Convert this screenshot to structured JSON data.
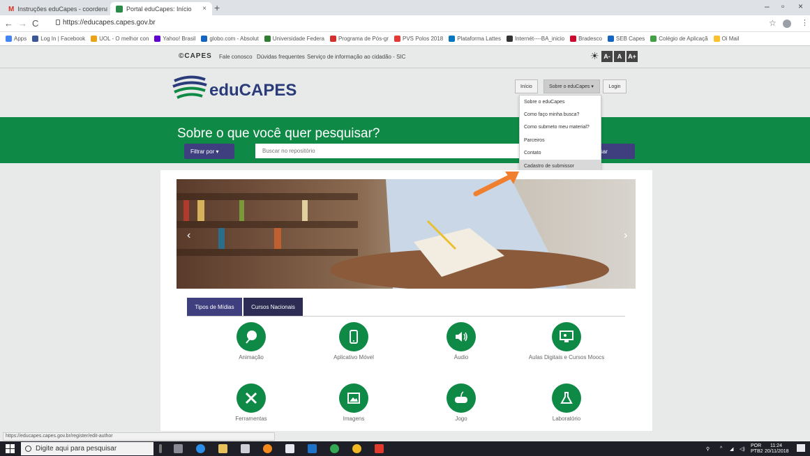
{
  "browser": {
    "tabs": [
      {
        "title": "Instruções eduCapes - coordena"
      },
      {
        "title": "Portal eduCapes: Início"
      }
    ],
    "url": "https://educapes.capes.gov.br",
    "bookmarks": [
      {
        "label": "Apps",
        "color": "#4285f4"
      },
      {
        "label": "Log In | Facebook",
        "color": "#3b5998"
      },
      {
        "label": "UOL - O melhor con",
        "color": "#e8a317"
      },
      {
        "label": "Yahoo! Brasil",
        "color": "#5f01d1"
      },
      {
        "label": "globo.com - Absolut",
        "color": "#1565c0"
      },
      {
        "label": "Universidade Federa",
        "color": "#2e7d32"
      },
      {
        "label": "Programa de Pós-gr",
        "color": "#d32f2f"
      },
      {
        "label": "PVS Polos 2018",
        "color": "#e53935"
      },
      {
        "label": "Plataforma Lattes",
        "color": "#0277bd"
      },
      {
        "label": "Internét----BA_inicio",
        "color": "#333333"
      },
      {
        "label": "Bradesco",
        "color": "#cc092f"
      },
      {
        "label": "SEB Capes",
        "color": "#1565c0"
      },
      {
        "label": "Colégio de Aplicaçã",
        "color": "#43a047"
      },
      {
        "label": "Oi Mail",
        "color": "#fbc02d"
      }
    ],
    "status_url": "https://educapes.capes.gov.br/register/edit-author"
  },
  "topnav": {
    "logo": "©CAPES",
    "links": [
      "Fale conosco",
      "Dúvidas frequentes",
      "Serviço de informação ao cidadão - SIC"
    ],
    "font_buttons": [
      "A-",
      "A",
      "A+"
    ]
  },
  "header": {
    "logo_text": "eduCAPES",
    "menu": {
      "inicio": "Início",
      "sobre": "Sobre o eduCapes ▾",
      "login": "Login"
    },
    "dropdown": [
      "Sobre o eduCapes",
      "Como faço minha busca?",
      "Como submeto meu material?",
      "Parceiros",
      "Contato",
      "Cadastro de submissor"
    ]
  },
  "search": {
    "question": "Sobre o que você quer pesquisar?",
    "filter_label": "Filtrar por ▾",
    "placeholder": "Buscar no repositório",
    "button_label": "isar"
  },
  "media_tabs": [
    "Tipos de Mídias",
    "Cursos Nacionais"
  ],
  "media_types": [
    {
      "label": "Animação",
      "icon": "animation-icon"
    },
    {
      "label": "Aplicativo Móvel",
      "icon": "mobile-app-icon"
    },
    {
      "label": "Áudio",
      "icon": "audio-icon"
    },
    {
      "label": "Aulas Digitais e Cursos Moocs",
      "icon": "digital-class-icon"
    },
    {
      "label": "Ferramentas",
      "icon": "tools-icon"
    },
    {
      "label": "Imagens",
      "icon": "image-icon"
    },
    {
      "label": "Jogo",
      "icon": "game-icon"
    },
    {
      "label": "Laboratório",
      "icon": "lab-icon"
    }
  ],
  "taskbar": {
    "search_placeholder": "Digite aqui para pesquisar",
    "lang": "POR",
    "lang2": "PTB2",
    "time": "11:24",
    "date": "20/11/2018"
  },
  "colors": {
    "green": "#0f8a46",
    "navy": "#3f3f7f",
    "logo_blue": "#2a3b7a",
    "arrow": "#f08030"
  }
}
